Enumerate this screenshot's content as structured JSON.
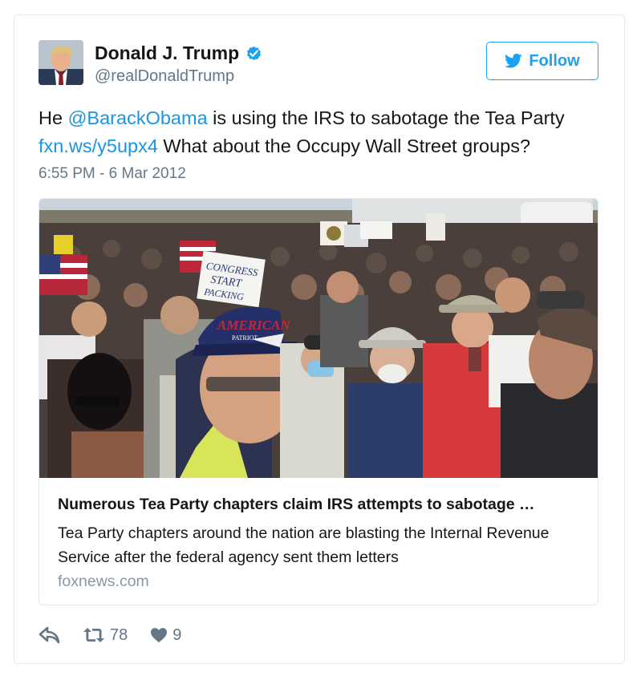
{
  "tweet": {
    "author": {
      "display_name": "Donald J. Trump",
      "handle": "@realDonaldTrump",
      "verified_icon": "verified-badge-icon",
      "avatar_icon": "avatar-photo"
    },
    "follow_label": "Follow",
    "text": {
      "part1": "He ",
      "mention": "@BarackObama",
      "part2": " is using the IRS to sabotage the Tea Party ",
      "link": "fxn.ws/y5upx4",
      "part3": " What about the Occupy Wall Street groups?"
    },
    "timestamp": "6:55 PM - 6 Mar 2012",
    "card": {
      "image_description_icon": "crowd-photo",
      "sign_text_1": "CONGRESS",
      "sign_text_2": "START",
      "sign_text_3": "PACKING",
      "hat_text_1": "AMERICAN",
      "hat_text_2": "PATRIOT",
      "title": "Numerous Tea Party chapters claim IRS attempts to sabotage …",
      "description": "Tea Party chapters around the nation are blasting the Internal Revenue Service after the federal agency sent them letters",
      "domain": "foxnews.com"
    },
    "actions": {
      "reply_icon": "reply-icon",
      "retweet_icon": "retweet-icon",
      "retweet_count": "78",
      "like_icon": "heart-icon",
      "like_count": "9"
    },
    "colors": {
      "link": "#1b95e0",
      "follow": "#1da1f2",
      "muted": "#657786",
      "border": "#e1e8ed"
    }
  }
}
